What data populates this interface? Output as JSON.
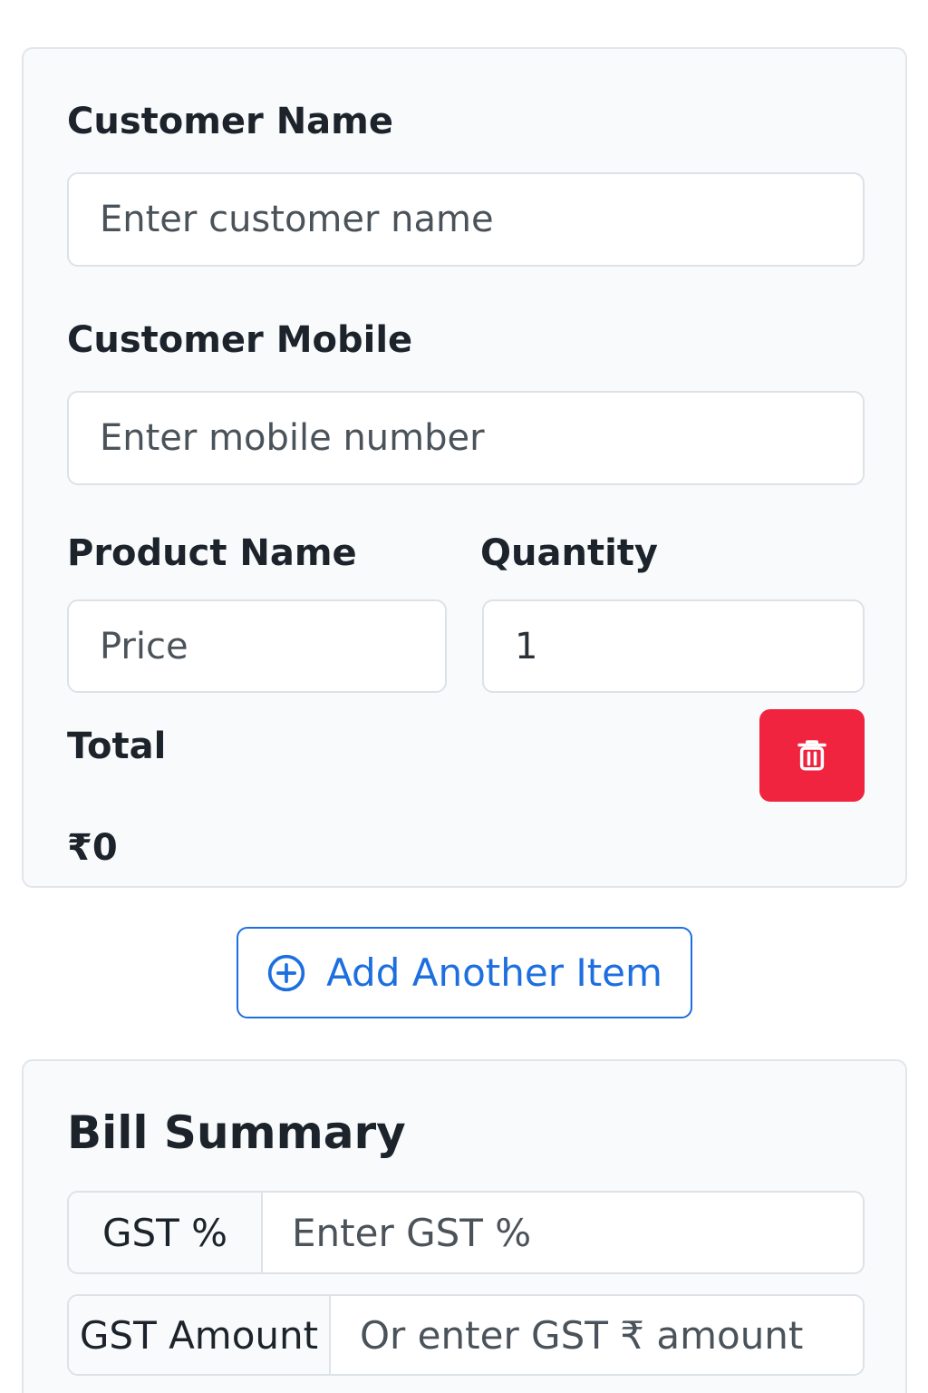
{
  "item_form": {
    "customer_name_label": "Customer Name",
    "customer_name_placeholder": "Enter customer name",
    "customer_mobile_label": "Customer Mobile",
    "customer_mobile_placeholder": "Enter mobile number",
    "product_name_label": "Product Name",
    "quantity_label": "Quantity",
    "price_placeholder": "Price",
    "quantity_value": "1",
    "total_label": "Total",
    "total_value": "₹0",
    "delete_icon": "trash-icon"
  },
  "add_item": {
    "label": "Add Another Item",
    "icon": "plus-circle-icon"
  },
  "bill_summary": {
    "title": "Bill Summary",
    "gst_percent_label": "GST %",
    "gst_percent_placeholder": "Enter GST %",
    "gst_amount_label": "GST Amount",
    "gst_amount_placeholder": "Or enter GST ₹ amount"
  },
  "colors": {
    "accent": "#1d6fe0",
    "danger": "#f0243f",
    "card_bg": "#f8fafc",
    "border": "#dde2e7"
  }
}
